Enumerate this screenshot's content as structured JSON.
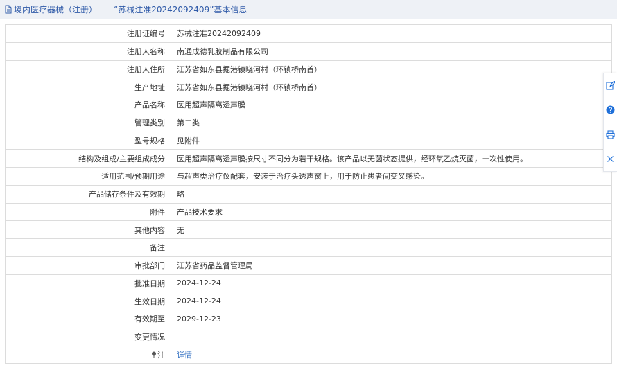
{
  "header": {
    "title": "境内医疗器械（注册）——“苏械注准20242092409”基本信息"
  },
  "rows": [
    {
      "label": "注册证编号",
      "value": "苏械注准20242092409"
    },
    {
      "label": "注册人名称",
      "value": "南通成德乳胶制品有限公司"
    },
    {
      "label": "注册人住所",
      "value": "江苏省如东县掘港镇晓河村（环镇桥南首）"
    },
    {
      "label": "生产地址",
      "value": "江苏省如东县掘港镇晓河村（环镇桥南首）"
    },
    {
      "label": "产品名称",
      "value": "医用超声隔离透声膜"
    },
    {
      "label": "管理类别",
      "value": "第二类"
    },
    {
      "label": "型号规格",
      "value": "见附件"
    },
    {
      "label": "结构及组成/主要组成成分",
      "value": "医用超声隔离透声膜按尺寸不同分为若干规格。该产品以无菌状态提供，经环氧乙烷灭菌，一次性使用。"
    },
    {
      "label": "适用范围/预期用途",
      "value": "与超声类治疗仪配套，安装于治疗头透声窗上，用于防止患者间交叉感染。"
    },
    {
      "label": "产品储存条件及有效期",
      "value": "略"
    },
    {
      "label": "附件",
      "value": "产品技术要求"
    },
    {
      "label": "其他内容",
      "value": "无"
    },
    {
      "label": "备注",
      "value": ""
    },
    {
      "label": "审批部门",
      "value": "江苏省药品监督管理局"
    },
    {
      "label": "批准日期",
      "value": "2024-12-24"
    },
    {
      "label": "生效日期",
      "value": "2024-12-24"
    },
    {
      "label": "有效期至",
      "value": "2029-12-23"
    },
    {
      "label": "变更情况",
      "value": ""
    }
  ],
  "note_row": {
    "label": "注",
    "link": "详情"
  },
  "toolbar": {
    "icons": [
      "edit-icon",
      "help-icon",
      "print-icon",
      "close-icon"
    ]
  },
  "colors": {
    "header_bg": "#eef1f6",
    "header_text": "#2f5aa8",
    "link": "#2f6ec1",
    "border": "#dcdcdc",
    "toolbar_blue": "#1e6fd9"
  }
}
